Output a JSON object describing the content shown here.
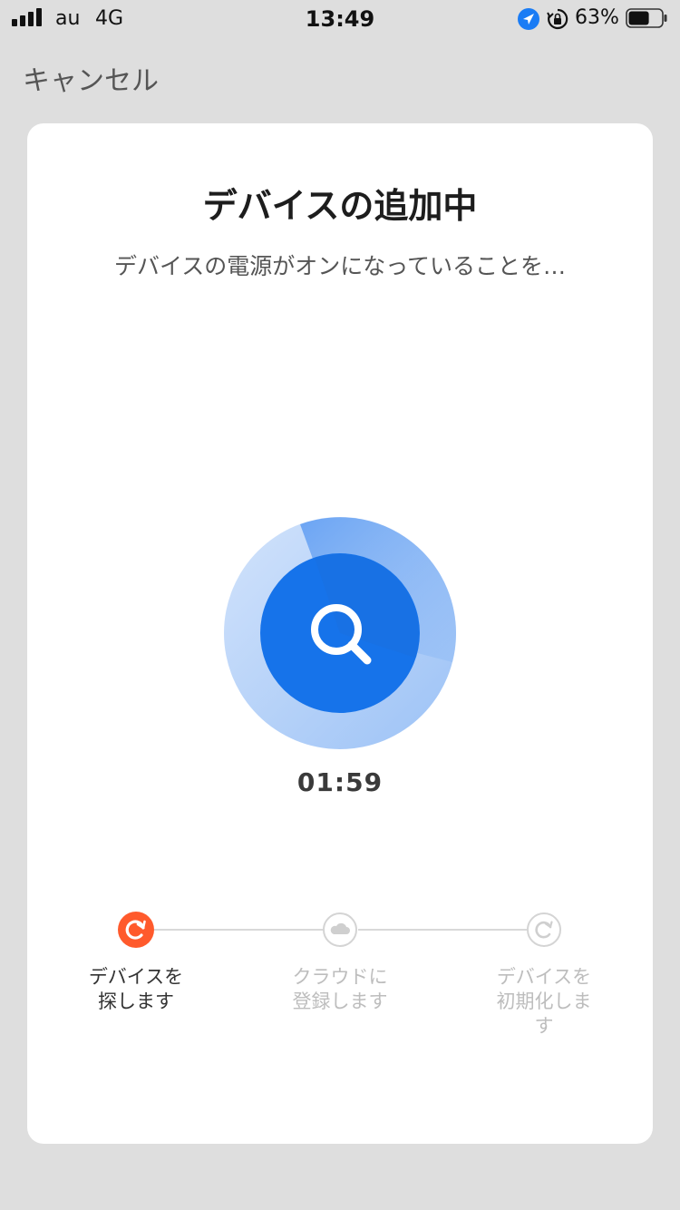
{
  "status_bar": {
    "carrier": "au",
    "network": "4G",
    "time": "13:49",
    "battery_percent": "63%",
    "battery_level": 0.63
  },
  "nav": {
    "cancel_label": "キャンセル"
  },
  "card": {
    "title": "デバイスの追加中",
    "subtitle": "デバイスの電源がオンになっていることを…",
    "timer": "01:59",
    "icon": "search-icon"
  },
  "steps": [
    {
      "label_line1": "デバイスを",
      "label_line2": "探します",
      "label_line3": "",
      "state": "active",
      "icon": "refresh-icon"
    },
    {
      "label_line1": "クラウドに",
      "label_line2": "登録します",
      "label_line3": "",
      "state": "pending",
      "icon": "cloud-icon"
    },
    {
      "label_line1": "デバイスを",
      "label_line2": "初期化しま",
      "label_line3": "す",
      "state": "pending",
      "icon": "reset-icon"
    }
  ],
  "colors": {
    "accent_blue": "#1673ea",
    "active_step": "#ff5a2c",
    "inactive": "#c8c8c8"
  }
}
